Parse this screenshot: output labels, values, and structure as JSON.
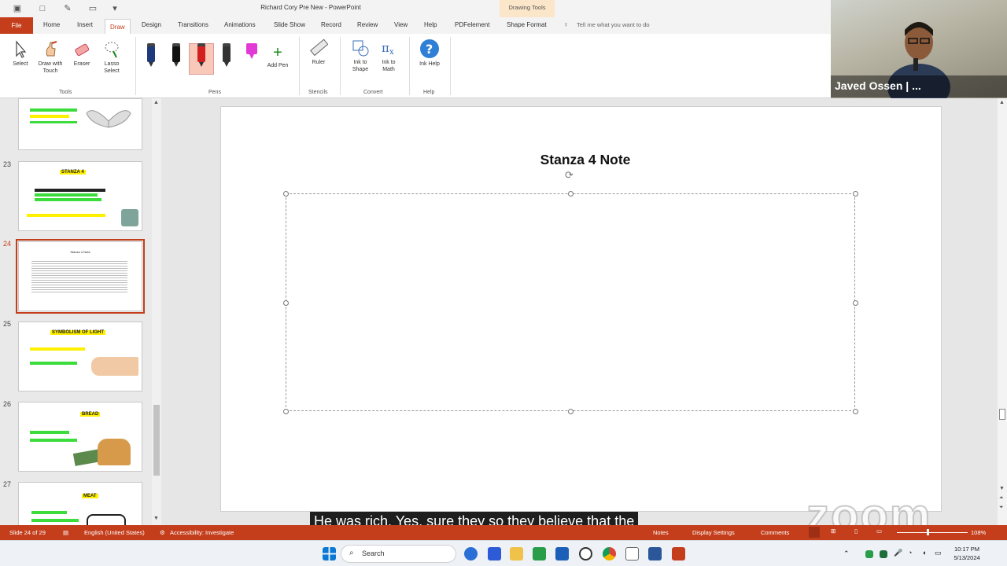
{
  "window": {
    "title": "Richard Cory Pre New  -  PowerPoint",
    "contextual_group": "Drawing Tools"
  },
  "tabs": [
    "File",
    "Home",
    "Insert",
    "Draw",
    "Design",
    "Transitions",
    "Animations",
    "Slide Show",
    "Record",
    "Review",
    "View",
    "Help",
    "PDFelement",
    "Shape Format"
  ],
  "tell_me": "Tell me what you want to do",
  "ribbon": {
    "tools": {
      "label": "Tools",
      "select": "Select",
      "draw_touch": "Draw with Touch",
      "eraser": "Eraser",
      "lasso": "Lasso Select"
    },
    "pens": {
      "label": "Pens",
      "add_pen": "Add Pen",
      "colors": [
        "#1f3a7a",
        "#111111",
        "#d21f1f",
        "#333333",
        "#e23ad6"
      ]
    },
    "stencils": {
      "label": "Stencils",
      "ruler": "Ruler"
    },
    "convert": {
      "label": "Convert",
      "ink_shape": "Ink to Shape",
      "ink_math": "Ink to Math"
    },
    "help": {
      "label": "Help",
      "ink_help": "Ink Help"
    }
  },
  "webcam": {
    "name": "Javed Ossen | ..."
  },
  "thumbnails": [
    {
      "num": "23",
      "title": "STANZA 4"
    },
    {
      "num": "24",
      "title": "Stanza 4 Note"
    },
    {
      "num": "25",
      "title": "SYMBOLISM OF LIGHT"
    },
    {
      "num": "26",
      "title": "BREAD"
    },
    {
      "num": "27",
      "title": "MEAT"
    }
  ],
  "slide": {
    "title": "Stanza 4 Note"
  },
  "caption": "He was rich. Yes, sure they so they believe that the",
  "zoom_watermark": "zoom",
  "statusbar": {
    "slide_info": "Slide 24 of 29",
    "language": "English (United States)",
    "accessibility": "Accessibility: Investigate",
    "notes": "Notes",
    "display": "Display Settings",
    "comments": "Comments",
    "zoom": "108%"
  },
  "taskbar": {
    "search": "Search",
    "time": "10:17 PM",
    "date": "5/13/2024"
  },
  "colors": {
    "accent": "#c43e1c",
    "gloss": "#4a7cc8"
  }
}
